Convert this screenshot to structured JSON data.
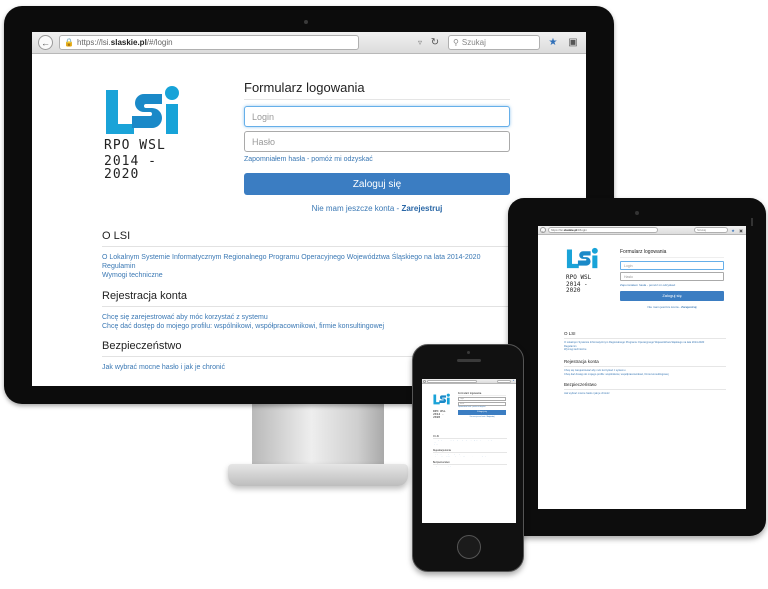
{
  "browser": {
    "url_prefix": "https://lsi.",
    "url_domain": "slaskie.pl",
    "url_path": "/#/login",
    "search_placeholder": "Szukaj",
    "back_glyph": "←",
    "reload_glyph": "↻",
    "dropdown_glyph": "▿",
    "star_glyph": "★",
    "icons": [
      "back-arrow-icon",
      "lock-icon",
      "reload-icon",
      "search-icon",
      "bookmark-star-icon",
      "library-icon"
    ]
  },
  "logo": {
    "letters": "LSi",
    "line1": "RPO WSL",
    "line2": "2014 - 2020",
    "colors": {
      "l": "#1aa3d8",
      "s": "#1a89c8",
      "i": "#17a3d8"
    }
  },
  "login": {
    "title": "Formularz logowania",
    "login_placeholder": "Login",
    "password_placeholder": "Hasło",
    "forgot_link": "Zapomniałem hasła - pomóż mi odzyskać",
    "submit_label": "Zaloguj się",
    "no_account_text": "Nie mam jeszcze konta - ",
    "register_link": "Zarejestruj",
    "button_color": "#3b7dc2"
  },
  "sections": {
    "about": {
      "title": "O LSI",
      "links": [
        "O Lokalnym Systemie Informatycznym Regionalnego Programu Operacyjnego Województwa Śląskiego na lata 2014-2020",
        "Regulamin",
        "Wymogi techniczne"
      ]
    },
    "registration": {
      "title": "Rejestracja konta",
      "links": [
        "Chcę się zarejestrować aby móc korzystać z systemu",
        "Chcę dać dostęp do mojego profilu: wspólnikowi, współpracownikowi, firmie konsultingowej"
      ]
    },
    "security": {
      "title": "Bezpieczeństwo",
      "links": [
        "Jak wybrać mocne hasło i jak je chronić"
      ]
    }
  }
}
